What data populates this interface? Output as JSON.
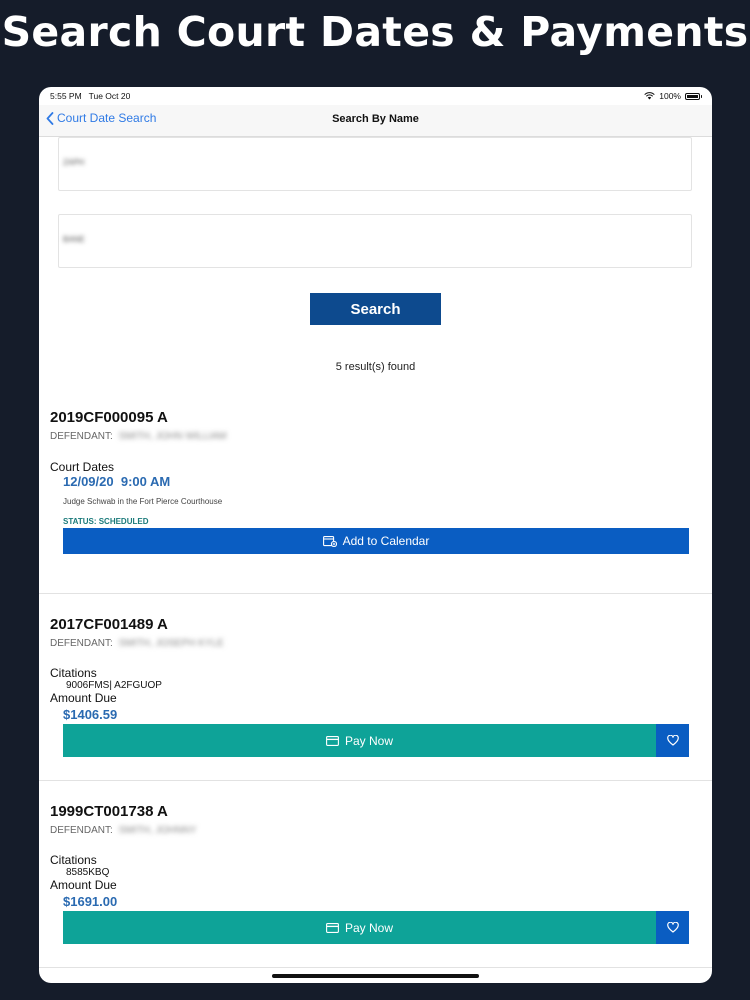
{
  "headline": "Search Court Dates & Payments",
  "statusbar": {
    "time": "5:55 PM",
    "date": "Tue Oct 20",
    "battery": "100%"
  },
  "nav": {
    "back_label": "Court Date Search",
    "title": "Search By Name"
  },
  "form": {
    "first_name_value": "ZAPH",
    "last_name_value": "BANE",
    "search_label": "Search"
  },
  "results_text": "5 result(s) found",
  "cases": [
    {
      "number": "2019CF000095 A",
      "defendant_label": "DEFENDANT:",
      "defendant_name": "SMITH, JOHN WILLIAM",
      "section_label": "Court Dates",
      "date": "12/09/20",
      "time": "9:00 AM",
      "location": "Judge Schwab in the Fort Pierce Courthouse",
      "status": "STATUS: SCHEDULED",
      "action_label": "Add to Calendar"
    },
    {
      "number": "2017CF001489 A",
      "defendant_label": "DEFENDANT:",
      "defendant_name": "SMITH, JOSEPH KYLE",
      "section_label": "Citations",
      "citation": "9006FMS| A2FGUOP",
      "amount_label": "Amount Due",
      "amount": "$1406.59",
      "action_label": "Pay Now"
    },
    {
      "number": "1999CT001738 A",
      "defendant_label": "DEFENDANT:",
      "defendant_name": "SMITH, JOHNNY",
      "section_label": "Citations",
      "citation": "8585KBQ",
      "amount_label": "Amount Due",
      "amount": "$1691.00",
      "action_label": "Pay Now"
    }
  ],
  "colors": {
    "background": "#151c2a",
    "primary": "#0d4a8e",
    "calendar": "#0a5dc2",
    "pay": "#0ea398",
    "link": "#2f7ae5"
  },
  "icons": [
    "back-chevron-icon",
    "wifi-icon",
    "battery-icon",
    "calendar-plus-icon",
    "credit-card-icon",
    "heart-icon"
  ]
}
